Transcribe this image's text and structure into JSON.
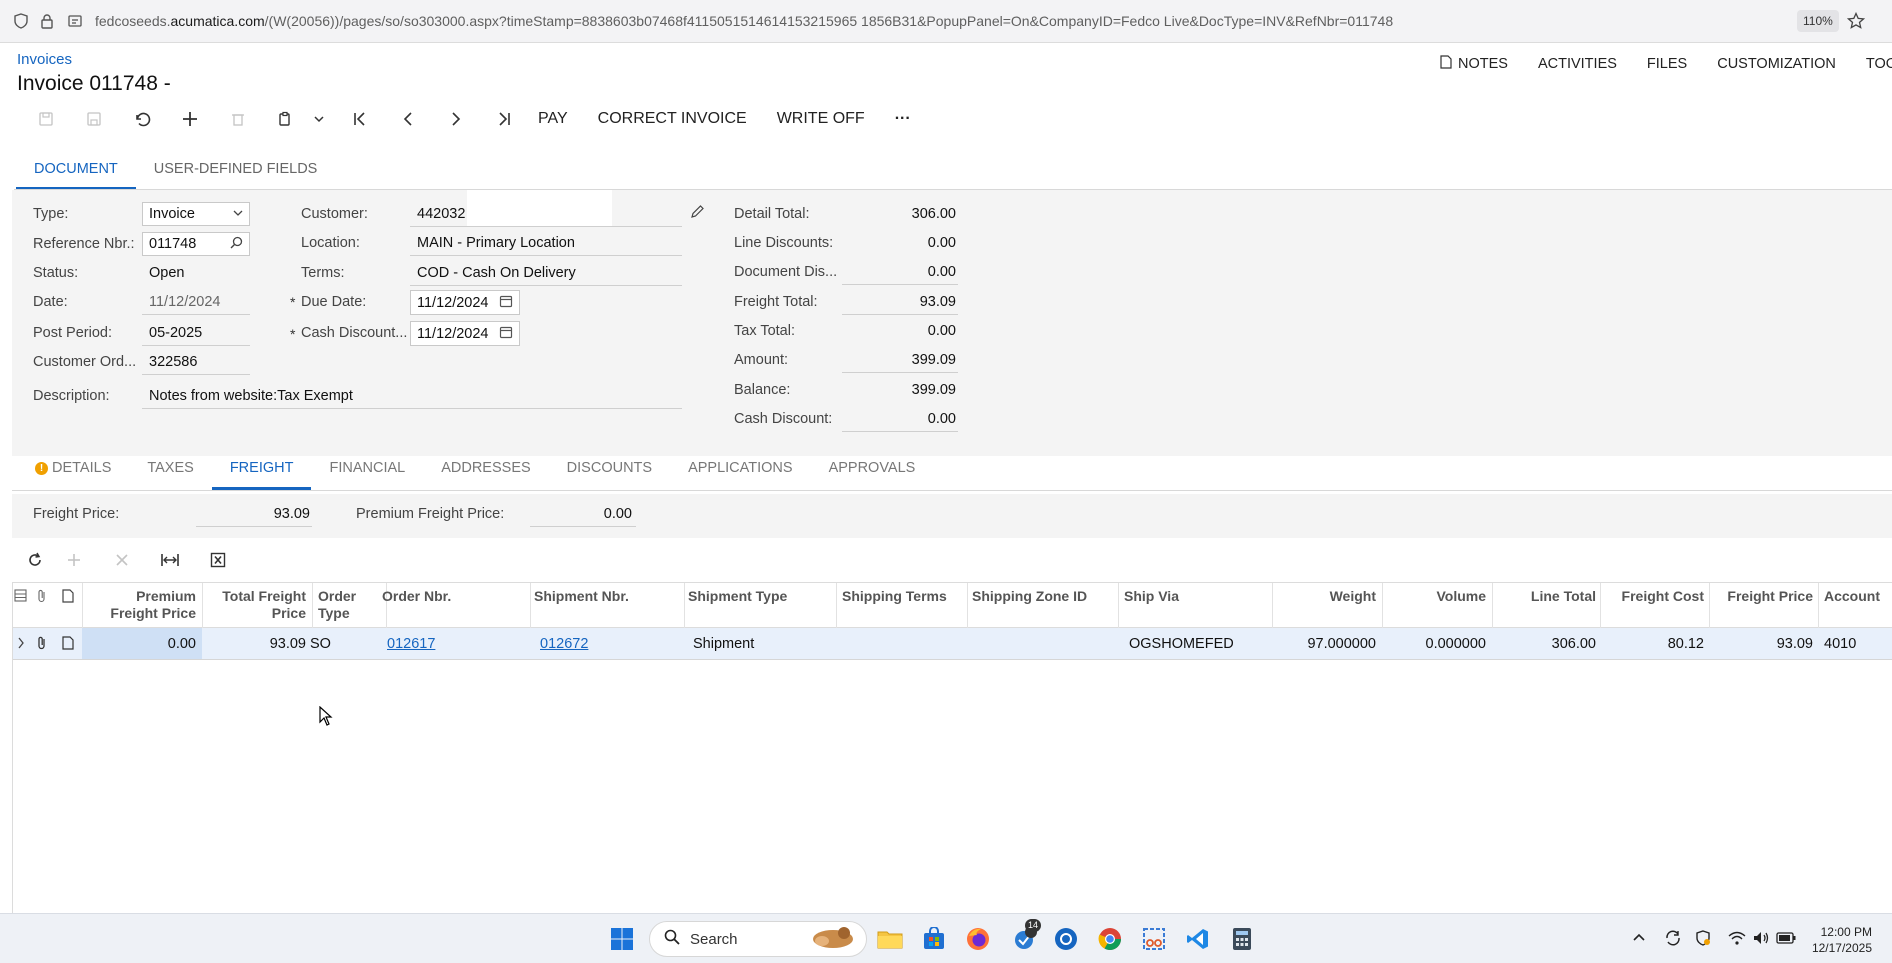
{
  "browser": {
    "url_prefix": "fedcoseeds.",
    "url_domain": "acumatica.com",
    "url_rest": "/(W(20056))/pages/so/so303000.aspx?timeStamp=8838603b07468f4115051514614153215965 1856B31&PopupPanel=On&CompanyID=Fedco Live&DocType=INV&RefNbr=011748",
    "zoom": "110%"
  },
  "header": {
    "breadcrumb": "Invoices",
    "title": "Invoice 011748 -",
    "top_actions": [
      "NOTES",
      "ACTIVITIES",
      "FILES",
      "CUSTOMIZATION",
      "TOOLS"
    ]
  },
  "toolbar": {
    "pay": "PAY",
    "correct_invoice": "CORRECT INVOICE",
    "write_off": "WRITE OFF",
    "more": "···"
  },
  "tabs_top": [
    "DOCUMENT",
    "USER-DEFINED FIELDS"
  ],
  "form": {
    "type_label": "Type:",
    "type_value": "Invoice",
    "refnbr_label": "Reference Nbr.:",
    "refnbr_value": "011748",
    "status_label": "Status:",
    "status_value": "Open",
    "date_label": "Date:",
    "date_value": "11/12/2024",
    "postperiod_label": "Post Period:",
    "postperiod_value": "05-2025",
    "custord_label": "Customer Ord...",
    "custord_value": "322586",
    "description_label": "Description:",
    "description_value": "Notes from website:Tax Exempt",
    "customer_label": "Customer:",
    "customer_value": "442032",
    "location_label": "Location:",
    "location_value": "MAIN - Primary Location",
    "terms_label": "Terms:",
    "terms_value": "COD - Cash On Delivery",
    "duedate_label": "Due Date:",
    "duedate_value": "11/12/2024",
    "cashdisc_label": "Cash Discount...",
    "cashdisc_value": "11/12/2024",
    "star": "*"
  },
  "totals": [
    {
      "label": "Detail Total:",
      "value": "306.00"
    },
    {
      "label": "Line Discounts:",
      "value": "0.00"
    },
    {
      "label": "Document Dis...",
      "value": "0.00"
    },
    {
      "label": "Freight Total:",
      "value": "93.09"
    },
    {
      "label": "Tax Total:",
      "value": "0.00"
    },
    {
      "label": "Amount:",
      "value": "399.09"
    },
    {
      "label": "Balance:",
      "value": "399.09"
    },
    {
      "label": "Cash Discount:",
      "value": "0.00"
    }
  ],
  "tabs_detail": [
    "DETAILS",
    "TAXES",
    "FREIGHT",
    "FINANCIAL",
    "ADDRESSES",
    "DISCOUNTS",
    "APPLICATIONS",
    "APPROVALS"
  ],
  "freight": {
    "price_label": "Freight Price:",
    "price_value": "93.09",
    "premium_label": "Premium Freight Price:",
    "premium_value": "0.00"
  },
  "grid": {
    "columns": [
      "Premium Freight Price",
      "Total Freight Price",
      "Order Type",
      "Order Nbr.",
      "Shipment Nbr.",
      "Shipment Type",
      "Shipping Terms",
      "Shipping Zone ID",
      "Ship Via",
      "Weight",
      "Volume",
      "Line Total",
      "Freight Cost",
      "Freight Price",
      "Account"
    ],
    "col_premium_1": "Premium",
    "col_premium_2": "Freight Price",
    "col_total_1": "Total Freight",
    "col_total_2": "Price",
    "col_ordertype_1": "Order",
    "col_ordertype_2": "Type",
    "row": {
      "premium": "0.00",
      "total": "93.09",
      "order_type": "SO",
      "order_nbr": "012617",
      "shipment_nbr": "012672",
      "shipment_type": "Shipment",
      "shipping_terms": "",
      "shipping_zone": "",
      "ship_via": "OGSHOMEFED",
      "weight": "97.000000",
      "volume": "0.000000",
      "line_total": "306.00",
      "freight_cost": "80.12",
      "freight_price": "93.09",
      "account": "4010"
    }
  },
  "taskbar": {
    "search": "Search",
    "badge": "14",
    "time": "12:00 PM",
    "date": "12/17/2025"
  }
}
